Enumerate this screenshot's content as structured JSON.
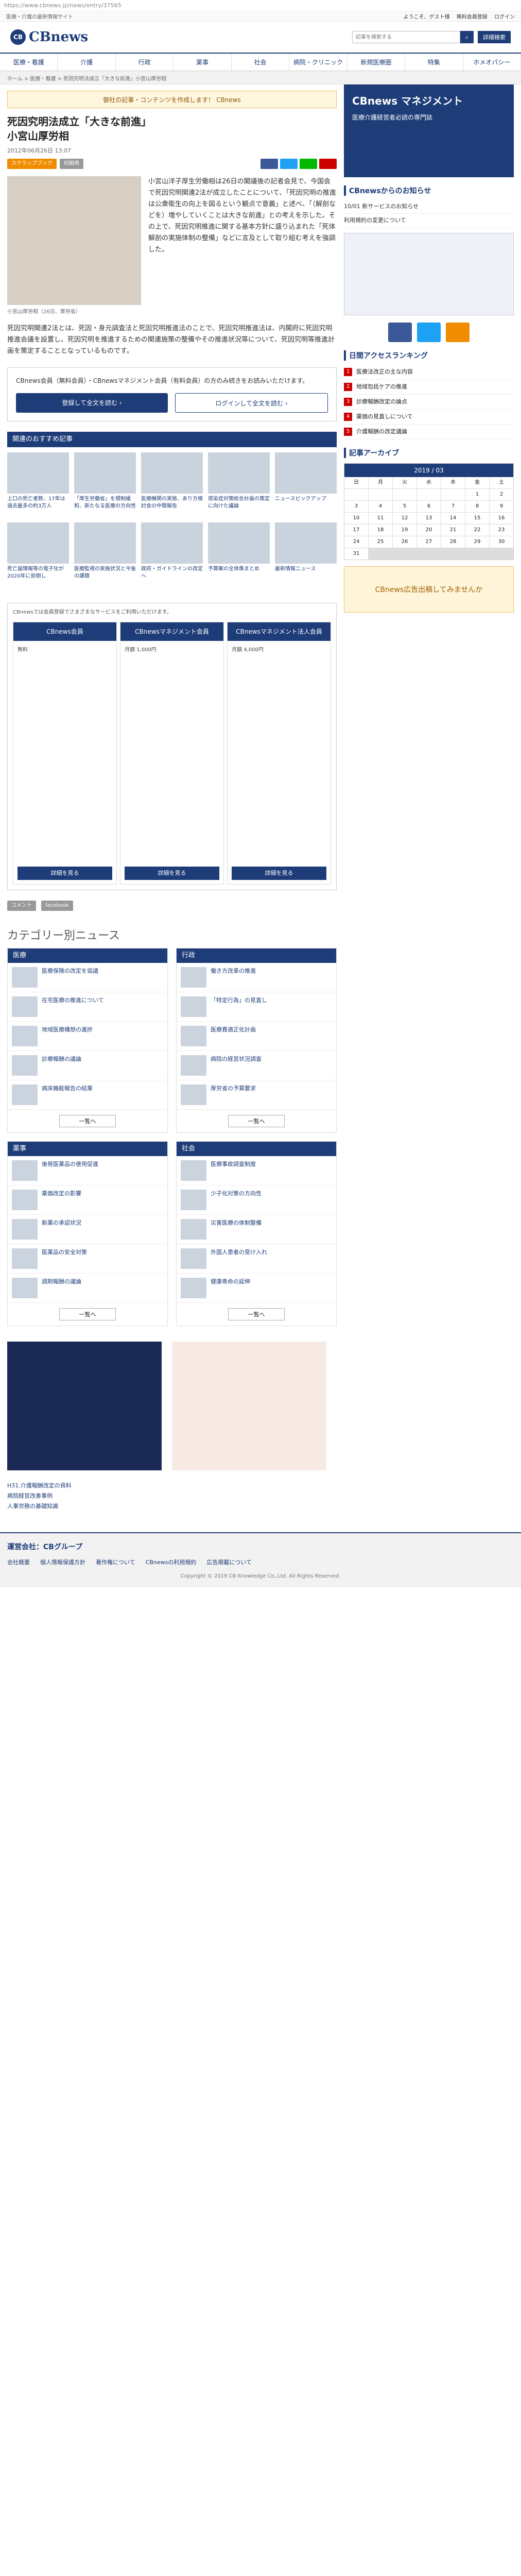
{
  "browser": {
    "url": "https://www.cbnews.jp/news/entry/37565"
  },
  "top_strip": {
    "left": "医療・介護の最新情報サイト",
    "links": [
      "ようこそ、ゲスト様",
      "無料会員登録",
      "ログイン"
    ]
  },
  "header": {
    "logo_mark": "CB",
    "logo_text": "CBnews",
    "search_placeholder": "記事を検索する",
    "advanced_label": "詳細検索"
  },
  "gnav": [
    "医療・看護",
    "介護",
    "行政",
    "薬事",
    "社会",
    "病院・クリニック",
    "新規医療圏",
    "特集",
    "ホメオパシー"
  ],
  "breadcrumb": "ホーム > 医療・看護 > 死因究明法成立「大きな前進」小宮山厚労相",
  "banner": "御社の記事・コンテンツを作成します！ CBnews",
  "article": {
    "title": "死因究明法成立「大きな前進」\n小宮山厚労相",
    "date": "2012年06月26日 13:07",
    "badge1": "スクラップブック",
    "badge2": "印刷用",
    "photo_caption": "小宮山厚労相（26日、厚労省）",
    "lead": "小宮山洋子厚生労働相は26日の閣議後の記者会見で、今国会で死因究明関連2法が成立したことについて、「死因究明の推進は公衆衛生の向上を図るという観点で意義」と述べ、「（解剖などを）増やしていくことは大きな前進」との考えを示した。その上で、死因究明推進に関する基本方針に盛り込まれた「死体解剖の実施体制の整備」などに言及として取り組む考えを強調した。",
    "body": "死因究明関連2法とは、死因・身元調査法と死因究明推進法のことで、死因究明推進法は、内閣府に死因究明推進会議を設置し、死因究明を推進するための関連施策の整備やその推進状況等について、死因究明等推進計画を策定することとなっているものです。"
  },
  "member_box": {
    "text": "CBnews会員（無料会員）・CBnewsマネジメント会員（有料会員）の方のみ続きをお読みいただけます。",
    "register": "登録して全文を読む ›",
    "login": "ログインして全文を読む ›"
  },
  "related": {
    "title": "関連のおすすめ記事",
    "items": [
      "上口の死亡者数、17年は過去最多の約3万人",
      "「厚生労働省」を規制緩和、新たなる医療の方向性",
      "医療機関の実態、あり方検討会の中間報告",
      "感染症対策総合計画の策定に向けた議論",
      "ニュースピックアップ",
      "死亡届情報等の電子化が2020年に前倒し",
      "医療監視の実施状況と今後の課題",
      "政府・ガイドラインの改定へ",
      "予算案の全体像まとめ",
      "最新情報ニュース"
    ]
  },
  "plans": {
    "note": "CBnewsでは会員登録でさまざまなサービスをご利用いただけます。",
    "cols": [
      {
        "head": "CBnews会員",
        "price": "無料",
        "btn": "詳細を見る"
      },
      {
        "head": "CBnewsマネジメント会員",
        "price": "月額 1,000円",
        "btn": "詳細を見る"
      },
      {
        "head": "CBnewsマネジメント法人会員",
        "price": "月額 4,000円",
        "btn": "詳細を見る"
      }
    ]
  },
  "comments": {
    "label": "コメント",
    "facebook": "facebook"
  },
  "categories": {
    "title": "カテゴリー別ニュース",
    "boxes": [
      {
        "head": "医療",
        "items": [
          "医療保険の改定を協議",
          "在宅医療の推進について",
          "地域医療構想の進捗",
          "診療報酬の議論",
          "病床機能報告の結果"
        ],
        "more": "一覧へ"
      },
      {
        "head": "行政",
        "items": [
          "働き方改革の推進",
          "「特定行為」の見直し",
          "医療費適正化計画",
          "病院の経営状況調査",
          "厚労省の予算要求"
        ],
        "more": "一覧へ"
      },
      {
        "head": "薬事",
        "items": [
          "後発医薬品の使用促進",
          "薬価改定の影響",
          "新薬の承認状況",
          "医薬品の安全対策",
          "調剤報酬の議論"
        ],
        "more": "一覧へ"
      },
      {
        "head": "社会",
        "items": [
          "医療事故調査制度",
          "少子化対策の方向性",
          "災害医療の体制整備",
          "外国人患者の受け入れ",
          "健康寿命の延伸"
        ],
        "more": "一覧へ"
      }
    ]
  },
  "side": {
    "ad_title": "CBnews マネジメント",
    "ad_sub": "医療介護経営者必読の専門誌",
    "notice_title": "CBnewsからのお知らせ",
    "notices": [
      "10/01 新サービスのお知らせ",
      "利用規約の変更について"
    ],
    "ranking_title": "日間アクセスランキング",
    "ranking": [
      "医療法改正の主な内容",
      "地域包括ケアの推進",
      "診療報酬改定の論点",
      "薬価の見直しについて",
      "介護報酬の改定議論"
    ],
    "archive_title": "記事アーカイブ",
    "calendar_month": "2019 / 03",
    "weekdays": [
      "日",
      "月",
      "火",
      "水",
      "木",
      "金",
      "土"
    ],
    "ad3": "CBnews広告出稿してみませんか"
  },
  "footer": {
    "links": [
      "H31.介護報酬改定の資料",
      "病院経営改善事例",
      "人事労務の基礎知識"
    ],
    "brand": "運営会社：CBグループ",
    "bottom_links": [
      "会社概要",
      "個人情報保護方針",
      "著作権について",
      "CBnewsの利用規約",
      "広告掲載について"
    ],
    "copyright": "Copyright © 2019 CB Knowledge Co.,Ltd. All Rights Reserved."
  }
}
